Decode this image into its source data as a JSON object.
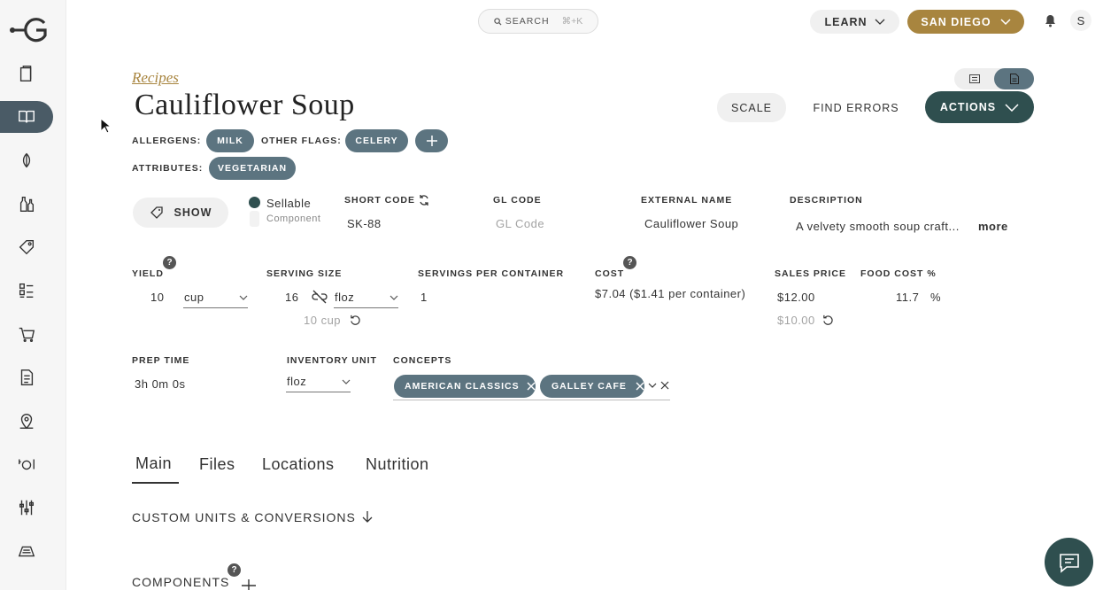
{
  "header": {
    "search_label": "SEARCH",
    "search_shortcut": "⌘+K",
    "learn_label": "LEARN",
    "location_label": "SAN DIEGO",
    "avatar_initial": "S",
    "colors": {
      "location": "#a8853f",
      "accent": "#2f4f4f",
      "tag": "#5c7480"
    }
  },
  "sidebar": {
    "items": [
      "clipboard-icon",
      "recipes-book-icon",
      "onion-icon",
      "bottles-icon",
      "tag-icon",
      "checklist-icon",
      "cart-icon",
      "document-icon",
      "location-pin-icon",
      "dining-icon",
      "sliders-icon",
      "ticket-icon"
    ],
    "active": "recipes-book-icon"
  },
  "page": {
    "breadcrumb": "Recipes",
    "title": "Cauliflower Soup",
    "scale_label": "SCALE",
    "find_errors_label": "FIND ERRORS",
    "actions_label": "ACTIONS"
  },
  "flags": {
    "allergens_label": "ALLERGENS:",
    "allergens": [
      "MILK"
    ],
    "other_flags_label": "OTHER FLAGS:",
    "other_flags": [
      "CELERY"
    ],
    "attributes_label": "ATTRIBUTES:",
    "attributes": [
      "VEGETARIAN"
    ]
  },
  "details": {
    "show_label": "SHOW",
    "sellable_label": "Sellable",
    "component_label": "Component",
    "short_code_label": "SHORT CODE",
    "short_code_value": "SK-88",
    "gl_code_label": "GL CODE",
    "gl_code_placeholder": "GL Code",
    "external_name_label": "EXTERNAL NAME",
    "external_name_value": "Cauliflower Soup",
    "description_label": "DESCRIPTION",
    "description_value": "A velvety smooth soup craft...",
    "more_label": "more"
  },
  "metrics": {
    "yield_label": "YIELD",
    "yield_value": "10",
    "yield_unit": "cup",
    "serving_size_label": "SERVING SIZE",
    "serving_size_value": "16",
    "serving_size_unit": "floz",
    "serving_conversion": "10 cup",
    "servings_per_container_label": "SERVINGS PER CONTAINER",
    "servings_per_container_value": "1",
    "cost_label": "COST",
    "cost_value": "$7.04 ($1.41 per container)",
    "sales_price_label": "SALES PRICE",
    "sales_price_value": "$12.00",
    "sales_price_suggested": "$10.00",
    "food_cost_label": "FOOD COST %",
    "food_cost_value": "11.7",
    "food_cost_unit": "%"
  },
  "more": {
    "prep_time_label": "PREP TIME",
    "prep_time_value": "3h 0m 0s",
    "inventory_unit_label": "INVENTORY UNIT",
    "inventory_unit_value": "floz",
    "concepts_label": "CONCEPTS",
    "concepts": [
      "AMERICAN CLASSICS",
      "GALLEY CAFE"
    ]
  },
  "tabs": [
    "Main",
    "Files",
    "Locations",
    "Nutrition"
  ],
  "active_tab": "Main",
  "sections": {
    "custom_units": "CUSTOM UNITS & CONVERSIONS",
    "components": "COMPONENTS"
  }
}
